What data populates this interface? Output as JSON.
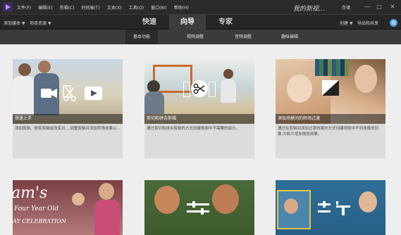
{
  "menubar": {
    "items": [
      "文件(F)",
      "编辑(E)",
      "剪辑(C)",
      "时间轴(T)",
      "文本(X)",
      "工具(O)",
      "窗口(W)",
      "帮助(H)"
    ],
    "project_name": "我的新视...",
    "save_label": "存储",
    "window_controls": [
      "—",
      "□",
      "✕"
    ]
  },
  "toolbar": {
    "add_media": "添加媒体",
    "project_assets": "项目资源",
    "modes": [
      "快速",
      "向导",
      "专家"
    ],
    "active_mode": "向导",
    "create": "创建",
    "share": "导出和共享"
  },
  "subtabs": {
    "items": [
      "基本功能",
      "视频调整",
      "音频调整",
      "趣味编辑"
    ],
    "active": "基本功能"
  },
  "cards": [
    {
      "title": "快速上手",
      "desc": "添加剪辑、修剪剪辑或改变对...,调整剪辑并添加转场效果以..."
    },
    {
      "title": "剪切和拼合剪辑",
      "desc": "通过剪切和拼合剪辑的方式创建视频中不需要的部分。"
    },
    {
      "title": "添加场景间的转场过渡",
      "desc": "通过在剪辑间添加过渡效果的方式创建视频中不同场景的切换,为影片增加视觉效果。"
    },
    {
      "title": "",
      "desc": ""
    },
    {
      "title": "",
      "desc": ""
    },
    {
      "title": "",
      "desc": ""
    }
  ],
  "card4_overlay": {
    "big": "am's",
    "line2": "Four Year Old",
    "line3": "AY CELEBRATION"
  },
  "colors": {
    "accent": "#4aa3df",
    "active_tab": "#3d3d3d",
    "content_bg": "#eeeeee"
  }
}
